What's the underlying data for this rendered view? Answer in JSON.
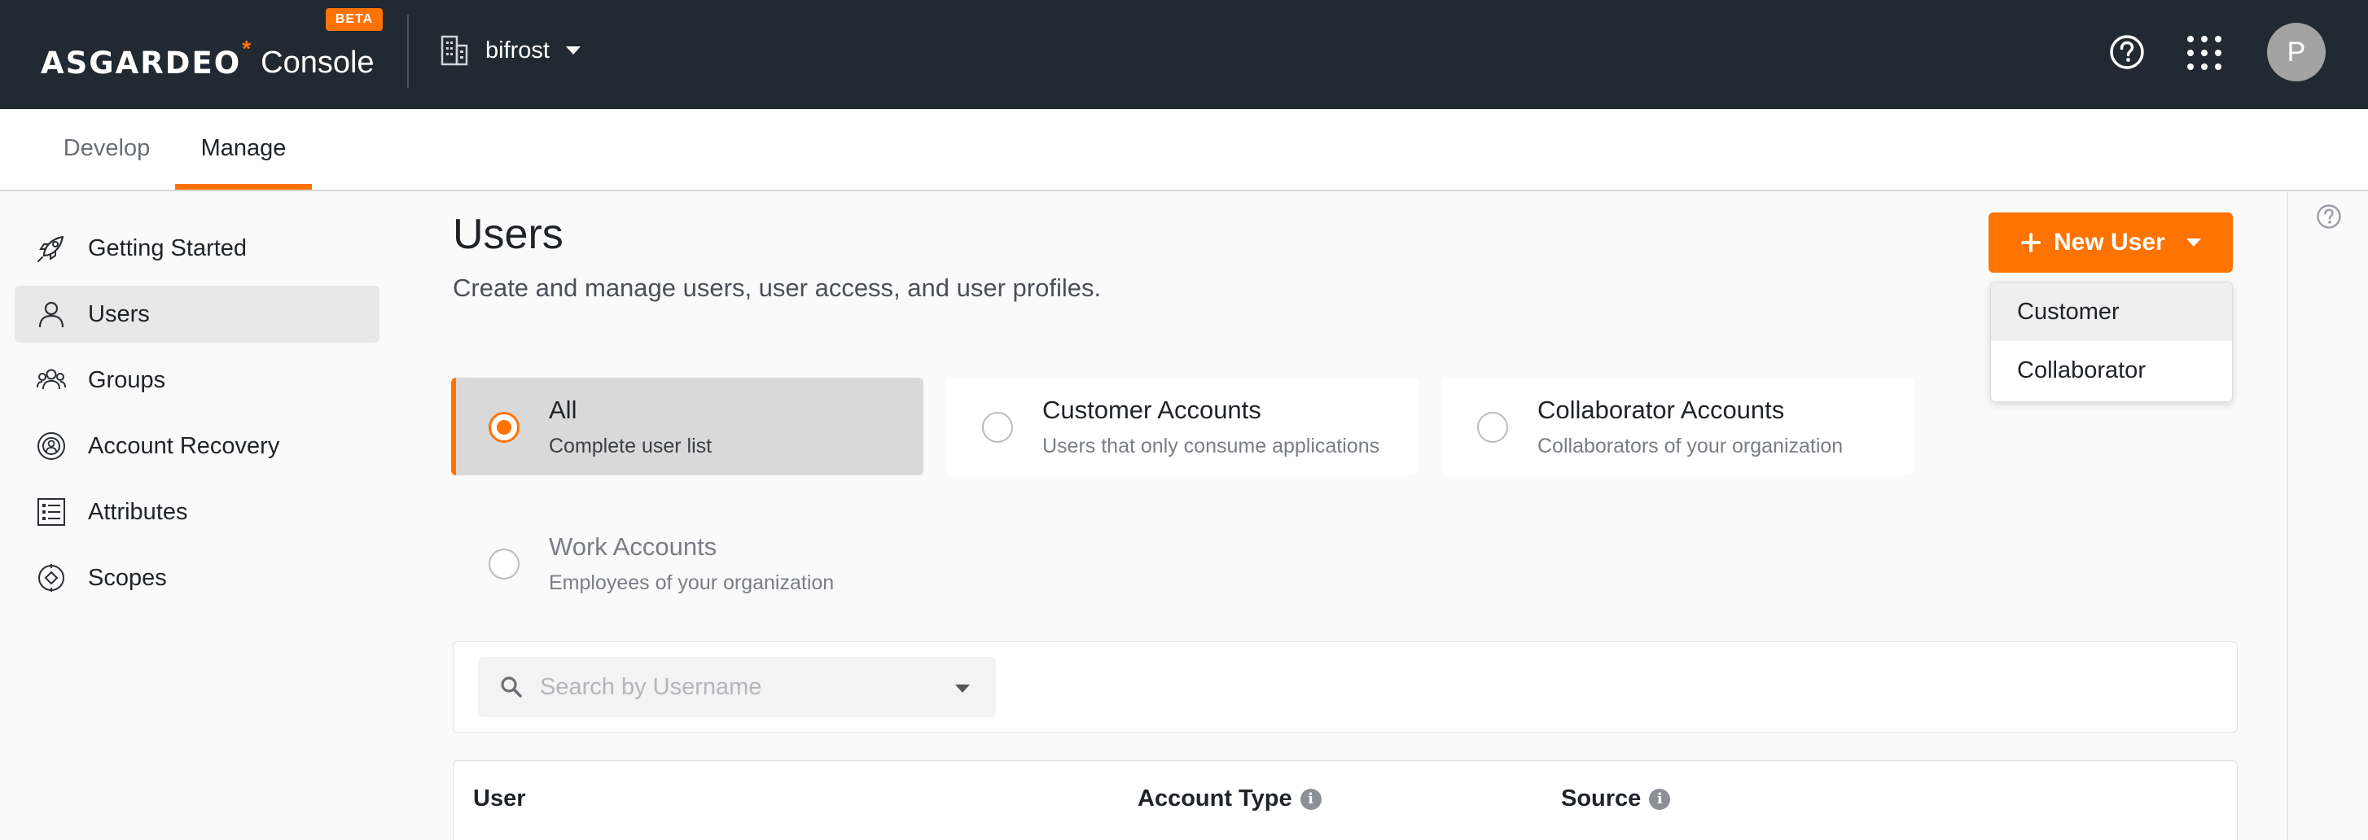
{
  "header": {
    "logo_text": "ASGARDEO",
    "logo_mark": "*",
    "console_label": "Console",
    "beta_badge": "BETA",
    "organization": "bifrost",
    "avatar_initial": "P",
    "icons": [
      "building-icon",
      "help-icon",
      "apps-grid-icon"
    ]
  },
  "tabs": [
    {
      "label": "Develop",
      "active": false
    },
    {
      "label": "Manage",
      "active": true
    }
  ],
  "sidebar": {
    "items": [
      {
        "label": "Getting Started",
        "icon": "rocket-icon",
        "active": false
      },
      {
        "label": "Users",
        "icon": "user-icon",
        "active": true
      },
      {
        "label": "Groups",
        "icon": "groups-icon",
        "active": false
      },
      {
        "label": "Account Recovery",
        "icon": "account-recovery-icon",
        "active": false
      },
      {
        "label": "Attributes",
        "icon": "attributes-icon",
        "active": false
      },
      {
        "label": "Scopes",
        "icon": "scopes-icon",
        "active": false
      }
    ]
  },
  "page": {
    "title": "Users",
    "description": "Create and manage users, user access, and user profiles."
  },
  "new_user_button": {
    "label": "New User",
    "menu": [
      "Customer",
      "Collaborator"
    ]
  },
  "filters": [
    {
      "title": "All",
      "subtitle": "Complete user list",
      "selected": true
    },
    {
      "title": "Customer Accounts",
      "subtitle": "Users that only consume applications",
      "selected": false
    },
    {
      "title": "Collaborator Accounts",
      "subtitle": "Collaborators of your organization",
      "selected": false
    },
    {
      "title": "Work Accounts",
      "subtitle": "Employees of your organization",
      "selected": false
    }
  ],
  "search": {
    "placeholder": "Search by Username",
    "value": ""
  },
  "table": {
    "columns": [
      "User",
      "Account Type",
      "Source"
    ]
  },
  "colors": {
    "accent": "#ff7300",
    "topbar": "#212932"
  }
}
